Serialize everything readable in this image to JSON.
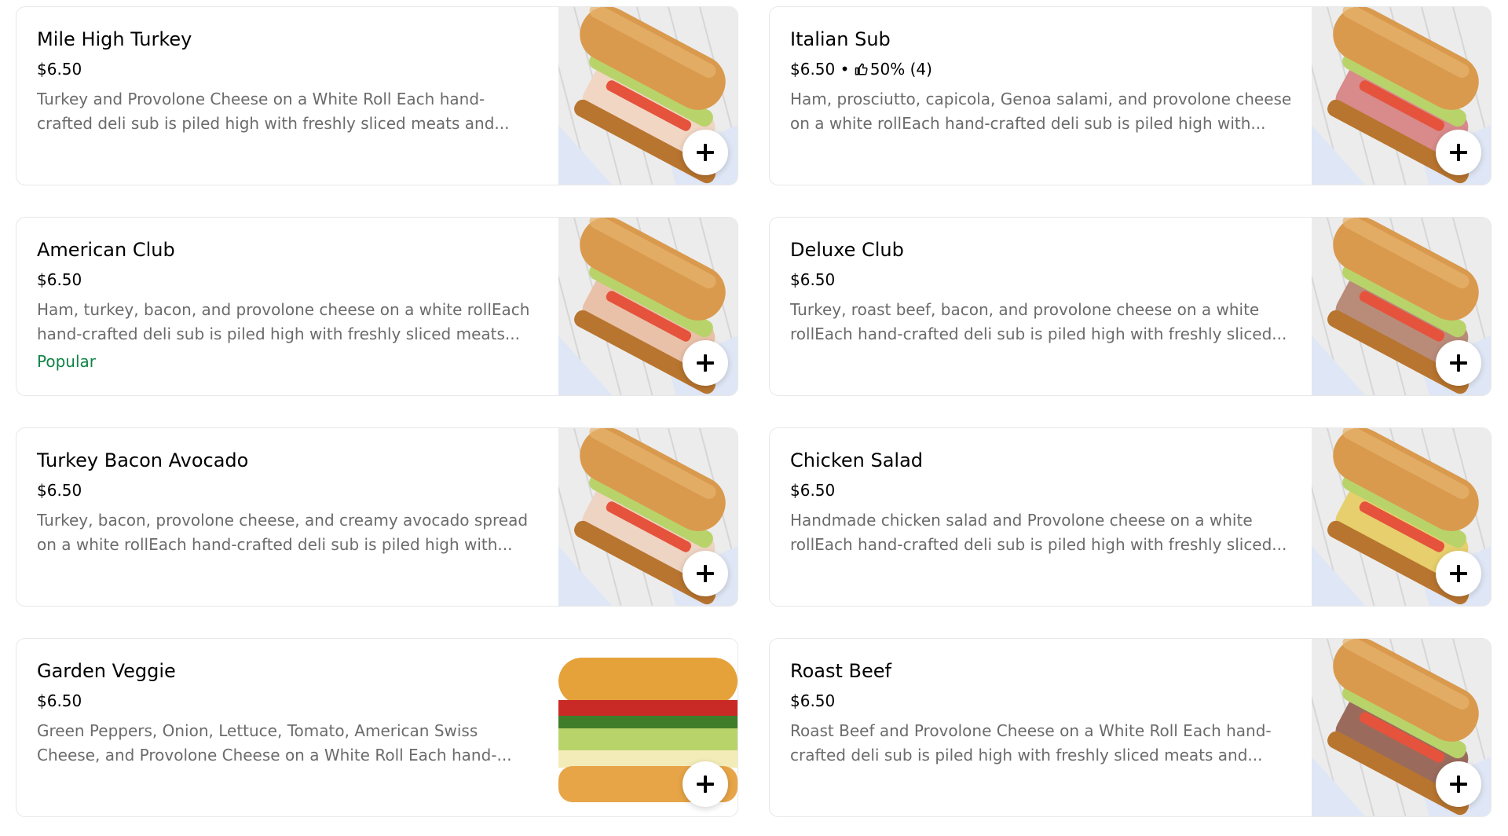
{
  "items": [
    {
      "title": "Mile High Turkey",
      "price": "$6.50",
      "description": "Turkey and Provolone Cheese on a White Roll Each hand-crafted deli sub is piled high with freshly sliced meats and...",
      "photo_alt": "sub-sandwich-photo",
      "filling": "#f1d6c4"
    },
    {
      "title": "Italian Sub",
      "price": "$6.50",
      "rating_separator": "•",
      "rating_text": "50% (4)",
      "rating_icon": "thumbs-up-icon",
      "description": "Ham, prosciutto, capicola, Genoa salami, and provolone cheese on a white rollEach hand-crafted deli sub is piled high with...",
      "photo_alt": "sub-sandwich-photo",
      "filling": "#d98a8a"
    },
    {
      "title": "American Club",
      "price": "$6.50",
      "description": "Ham, turkey, bacon, and provolone cheese on a white rollEach hand-crafted deli sub is piled high with freshly sliced meats...",
      "badge": "Popular",
      "photo_alt": "sub-sandwich-photo",
      "filling": "#e9c1a8"
    },
    {
      "title": "Deluxe Club",
      "price": "$6.50",
      "description": "Turkey, roast beef, bacon, and provolone cheese on a white rollEach hand-crafted deli sub is piled high with freshly sliced...",
      "photo_alt": "sub-sandwich-photo",
      "filling": "#b98c79"
    },
    {
      "title": "Turkey Bacon Avocado",
      "price": "$6.50",
      "description": "Turkey, bacon, provolone cheese, and creamy avocado spread on a white rollEach hand-crafted deli sub is piled high with...",
      "photo_alt": "sub-sandwich-photo",
      "filling": "#eed4c2"
    },
    {
      "title": "Chicken Salad",
      "price": "$6.50",
      "description": "Handmade chicken salad and Provolone cheese on a white rollEach hand-crafted deli sub is piled high with freshly sliced...",
      "photo_alt": "sub-sandwich-photo",
      "filling": "#e6cf6c"
    },
    {
      "title": "Garden Veggie",
      "price": "$6.50",
      "description": "Green Peppers, Onion, Lettuce, Tomato, American Swiss Cheese, and Provolone Cheese on a White Roll Each hand-...",
      "photo_alt": "veggie-sub-photo",
      "filling": "#8fbf52"
    },
    {
      "title": "Roast Beef",
      "price": "$6.50",
      "description": "Roast Beef and Provolone Cheese on a White Roll Each hand-crafted deli sub is piled high with freshly sliced meats and...",
      "photo_alt": "sub-sandwich-photo",
      "filling": "#9a6b5c"
    }
  ],
  "colors": {
    "badge_green": "#0e8345",
    "description_gray": "#6b6b6b",
    "bread": "#d99a4e",
    "bread_dark": "#b8752f",
    "lettuce": "#b9d36b",
    "tomato": "#e5533d",
    "paper": "#ececec",
    "paper_blue": "#3a5fb8"
  },
  "add_button_icon": "plus-icon"
}
